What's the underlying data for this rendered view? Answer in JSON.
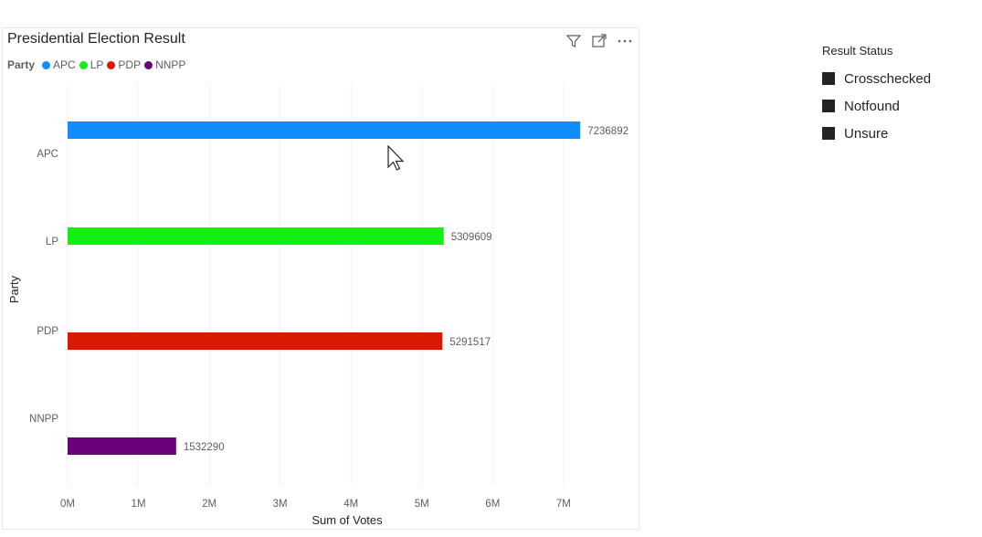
{
  "chart_data": {
    "type": "bar",
    "orientation": "horizontal",
    "title": "Presidential Election Result",
    "categories": [
      "APC",
      "LP",
      "PDP",
      "NNPP"
    ],
    "values": [
      7236892,
      5309609,
      5291517,
      1532290
    ],
    "colors": [
      "#118DFF",
      "#12EF12",
      "#DA1A00",
      "#6B007B"
    ],
    "xlabel": "Sum of Votes",
    "ylabel": "Party",
    "xlim": [
      0,
      7800000
    ],
    "x_ticks": [
      0,
      1000000,
      2000000,
      3000000,
      4000000,
      5000000,
      6000000,
      7000000
    ],
    "x_tick_labels": [
      "0M",
      "1M",
      "2M",
      "3M",
      "4M",
      "5M",
      "6M",
      "7M"
    ],
    "data_labels": [
      "7236892",
      "5309609",
      "5291517",
      "1532290"
    ],
    "legend": {
      "title": "Party",
      "position": "top-left",
      "entries": [
        "APC",
        "LP",
        "PDP",
        "NNPP"
      ]
    },
    "grid": true
  },
  "slicer": {
    "title": "Result Status",
    "items": [
      "Crosschecked",
      "Notfound",
      "Unsure"
    ]
  },
  "icons": [
    "filter-icon",
    "focus-mode-icon",
    "more-options-icon"
  ]
}
